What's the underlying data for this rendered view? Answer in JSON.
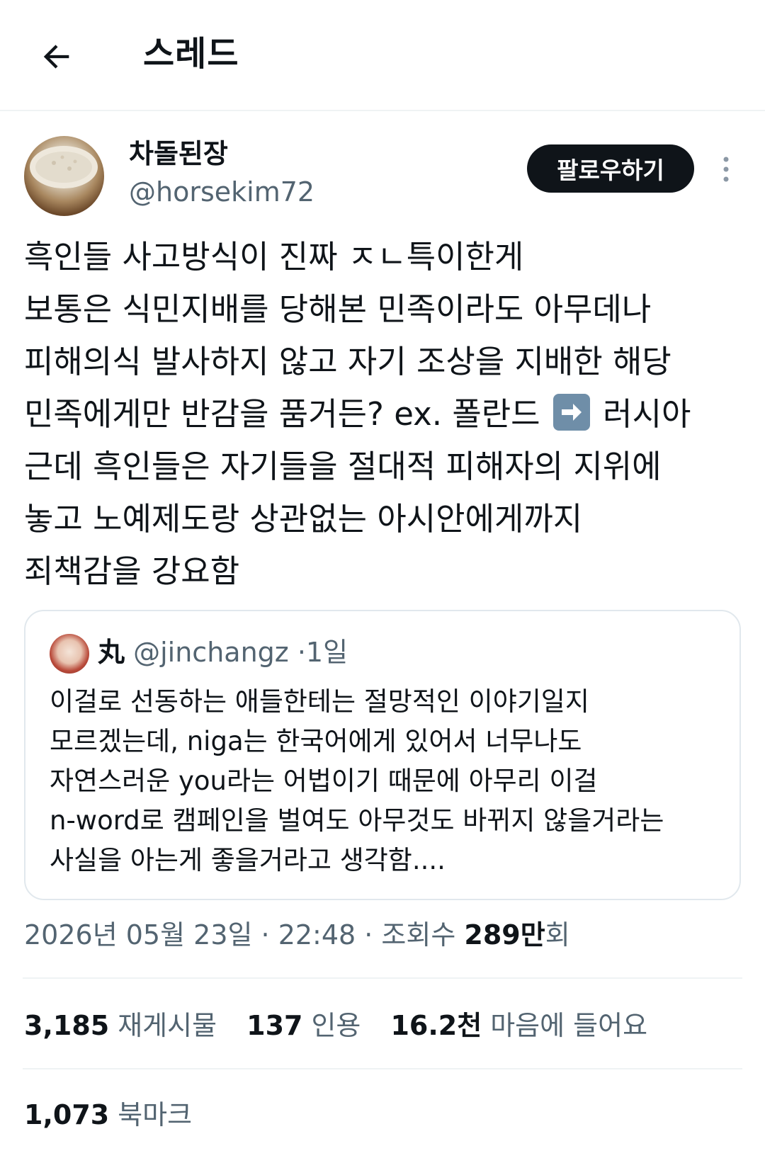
{
  "header": {
    "title": "스레드"
  },
  "author": {
    "name": "차돌된장",
    "handle": "@horsekim72",
    "follow_label": "팔로우하기"
  },
  "tweet": {
    "lines": [
      "흑인들 사고방식이 진짜 ㅈㄴ특이한게",
      "보통은 식민지배를 당해본 민족이라도 아무데나",
      "피해의식 발사하지 않고 자기 조상을 지배한 해당",
      "민족에게만 반감을 품거든? ex. 폴란드",
      "러시아",
      "근데 흑인들은 자기들을 절대적 피해자의 지위에",
      "놓고 노예제도랑 상관없는 아시안에게까지",
      "죄책감을 강요함"
    ]
  },
  "quote": {
    "name": "丸",
    "handle": "@jinchangz",
    "age": "1일",
    "lines": [
      "이걸로 선동하는 애들한테는 절망적인 이야기일지",
      "모르겠는데, niga는 한국어에게 있어서 너무나도",
      "자연스러운 you라는 어법이기 때문에 아무리 이걸",
      "n-word로 캠페인을 벌여도 아무것도 바뀌지 않을거라는",
      "사실을 아는게 좋을거라고 생각함...."
    ]
  },
  "meta": {
    "datetime": "2026년 05월 23일 · 22:48 · 조회수 ",
    "views_count": "289만",
    "views_suffix": "회"
  },
  "stats": {
    "reposts_count": "3,185",
    "reposts_label": "재게시물",
    "quotes_count": "137",
    "quotes_label": "인용",
    "likes_count": "16.2천",
    "likes_label": "마음에 들어요",
    "bookmarks_count": "1,073",
    "bookmarks_label": "북마크"
  },
  "icons": {
    "back": "arrow-left-icon",
    "more": "more-vertical-icon",
    "emoji": "right-arrow-emoji"
  }
}
